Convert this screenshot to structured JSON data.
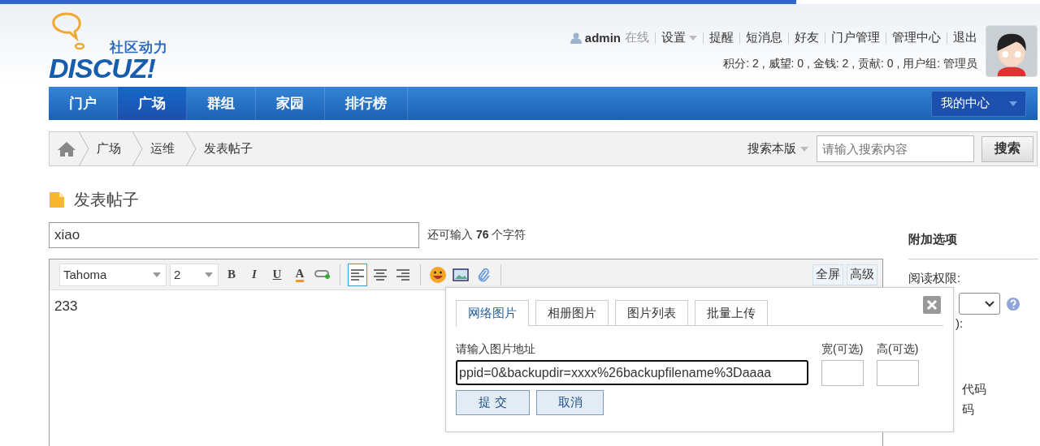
{
  "logo": {
    "tagline": "社区动力",
    "wordmark": "DISCUZ!"
  },
  "user_bar": {
    "username": "admin",
    "status": "在线",
    "links": [
      {
        "label": "设置",
        "dropdown": true
      },
      {
        "label": "提醒",
        "dropdown": false
      },
      {
        "label": "短消息",
        "dropdown": false
      },
      {
        "label": "好友",
        "dropdown": false
      },
      {
        "label": "门户管理",
        "dropdown": false
      },
      {
        "label": "管理中心",
        "dropdown": false
      },
      {
        "label": "退出",
        "dropdown": false
      }
    ],
    "stats": "积分: 2 , 威望: 0 , 金钱: 2 , 贡献: 0 , 用户组: 管理员"
  },
  "nav": {
    "items": [
      {
        "label": "门户",
        "selected": false
      },
      {
        "label": "广场",
        "selected": true
      },
      {
        "label": "群组",
        "selected": false
      },
      {
        "label": "家园",
        "selected": false
      },
      {
        "label": "排行榜",
        "selected": false
      }
    ],
    "my_center": "我的中心"
  },
  "breadcrumb": {
    "items": [
      "广场",
      "运维",
      "发表帖子"
    ],
    "search_scope": "搜索本版",
    "search_placeholder": "请输入搜索内容",
    "search_button": "搜索"
  },
  "page_title": "发表帖子",
  "subject": {
    "value": "xiao",
    "hint": "还可输入 **76** 个字符"
  },
  "editor": {
    "font": "Tahoma",
    "size": "2",
    "tools": [
      {
        "kind": "bold",
        "glyph": "B",
        "selected": false
      },
      {
        "kind": "italic",
        "glyph": "I",
        "selected": false
      },
      {
        "kind": "underline",
        "glyph": "U",
        "selected": false
      },
      {
        "kind": "color",
        "glyph": "A",
        "selected": false
      },
      {
        "kind": "link",
        "selected": false
      },
      {
        "kind": "align-left",
        "selected": true
      },
      {
        "kind": "align-center",
        "selected": false
      },
      {
        "kind": "align-right",
        "selected": false
      },
      {
        "kind": "emoji",
        "selected": false
      },
      {
        "kind": "image",
        "selected": false
      },
      {
        "kind": "attach",
        "selected": false
      }
    ],
    "right_buttons": [
      "全屏",
      "高级"
    ],
    "content": "233"
  },
  "dialog": {
    "tabs": [
      {
        "label": "网络图片",
        "selected": true
      },
      {
        "label": "相册图片",
        "selected": false
      },
      {
        "label": "图片列表",
        "selected": false
      },
      {
        "label": "批量上传",
        "selected": false
      }
    ],
    "url_label": "请输入图片地址",
    "url_value": "ppid=0&backupdir=xxxx%26backupfilename%3Daaaa",
    "width_label": "宽(可选)",
    "height_label": "高(可选)",
    "buttons": [
      "提 交",
      "取消"
    ]
  },
  "sidebar": {
    "title": "附加选项",
    "read_label": "阅读权限:",
    "fragments": [
      "):",
      "代码",
      "码"
    ]
  }
}
